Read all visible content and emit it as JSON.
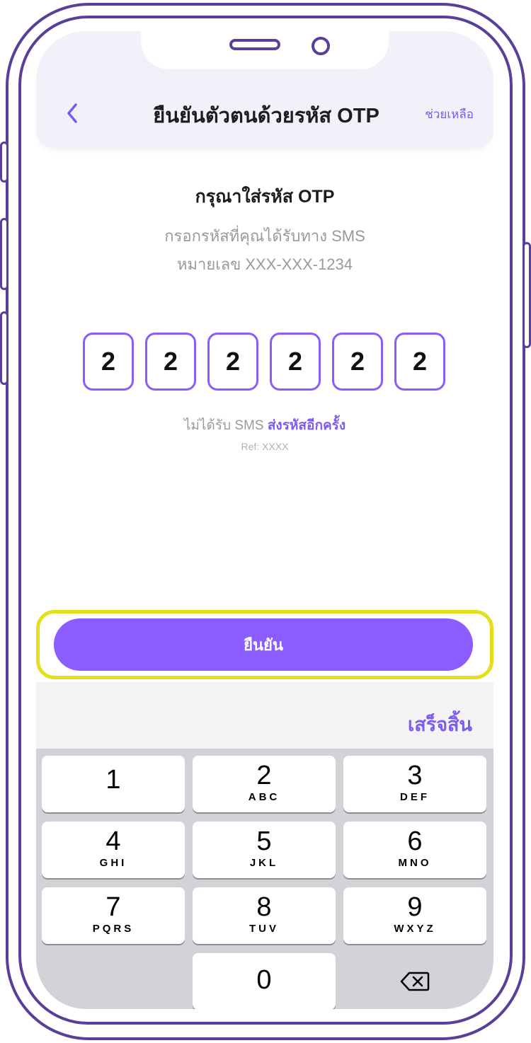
{
  "header": {
    "back_icon": "chevron-left-icon",
    "title": "ยืนยันตัวตนด้วยรหัส OTP",
    "help_label": "ช่วยเหลือ"
  },
  "content": {
    "title": "กรุณาใส่รหัส OTP",
    "subtitle_line1": "กรอกรหัสที่คุณได้รับทาง SMS",
    "subtitle_line2": "หมายเลข XXX-XXX-1234",
    "otp_digits": [
      "2",
      "2",
      "2",
      "2",
      "2",
      "2"
    ],
    "resend_prefix": "ไม่ได้รับ SMS",
    "resend_link": "ส่งรหัสอีกครั้ง",
    "ref": "Ref: XXXX"
  },
  "confirm_label": "ยืนยัน",
  "keyboard": {
    "done_label": "เสร็จสิ้น",
    "keys": [
      {
        "num": "1",
        "letters": ""
      },
      {
        "num": "2",
        "letters": "ABC"
      },
      {
        "num": "3",
        "letters": "DEF"
      },
      {
        "num": "4",
        "letters": "GHI"
      },
      {
        "num": "5",
        "letters": "JKL"
      },
      {
        "num": "6",
        "letters": "MNO"
      },
      {
        "num": "7",
        "letters": "PQRS"
      },
      {
        "num": "8",
        "letters": "TUV"
      },
      {
        "num": "9",
        "letters": "WXYZ"
      },
      {
        "num": "0",
        "letters": ""
      }
    ],
    "backspace_icon": "backspace-icon"
  },
  "colors": {
    "accent": "#8b5cff",
    "frame": "#5a3f9a",
    "highlight": "#e3e01b"
  }
}
